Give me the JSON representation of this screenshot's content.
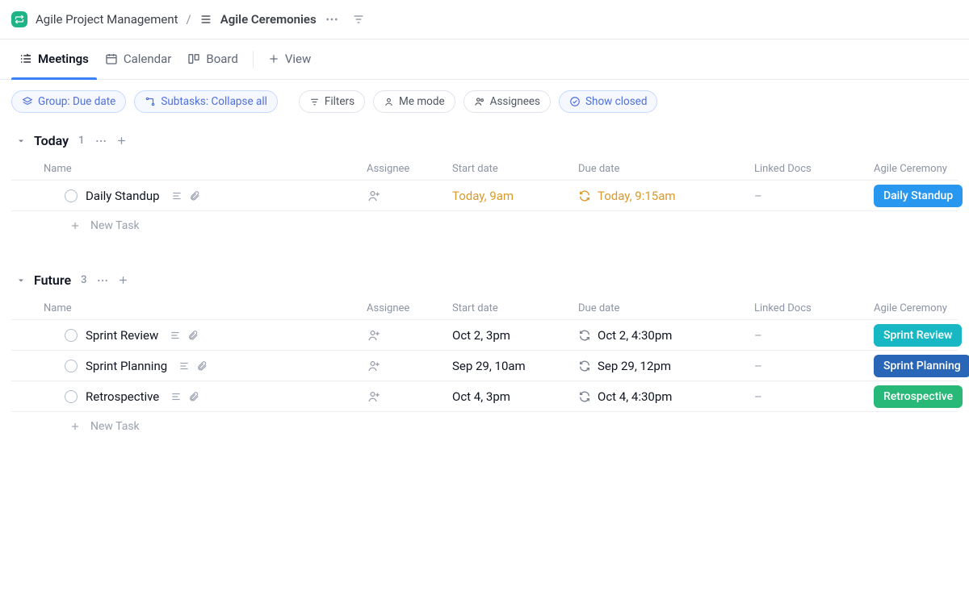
{
  "breadcrumb": {
    "space": "Agile Project Management",
    "listIcon": "list",
    "list": "Agile Ceremonies"
  },
  "tabs": [
    {
      "id": "meetings",
      "label": "Meetings",
      "icon": "list-check",
      "active": true
    },
    {
      "id": "calendar",
      "label": "Calendar",
      "icon": "calendar",
      "active": false
    },
    {
      "id": "board",
      "label": "Board",
      "icon": "board",
      "active": false
    }
  ],
  "addView": "View",
  "filters": {
    "group": "Group: Due date",
    "subtasks": "Subtasks: Collapse all",
    "filters": "Filters",
    "meMode": "Me mode",
    "assignees": "Assignees",
    "showClosed": "Show closed"
  },
  "columns": {
    "name": "Name",
    "assignee": "Assignee",
    "startDate": "Start date",
    "dueDate": "Due date",
    "linkedDocs": "Linked Docs",
    "ceremony": "Agile Ceremony"
  },
  "groups": [
    {
      "id": "today",
      "title": "Today",
      "count": "1",
      "rows": [
        {
          "name": "Daily Standup",
          "start": "Today, 9am",
          "due": "Today, 9:15am",
          "recurring": true,
          "dateStyle": "orange",
          "docs": "–",
          "tag": {
            "label": "Daily Standup",
            "color": "blue"
          }
        }
      ]
    },
    {
      "id": "future",
      "title": "Future",
      "count": "3",
      "rows": [
        {
          "name": "Sprint Review",
          "start": "Oct 2, 3pm",
          "due": "Oct 2, 4:30pm",
          "recurring": true,
          "dateStyle": "",
          "docs": "–",
          "tag": {
            "label": "Sprint Review",
            "color": "teal"
          }
        },
        {
          "name": "Sprint Planning",
          "start": "Sep 29, 10am",
          "due": "Sep 29, 12pm",
          "recurring": true,
          "dateStyle": "",
          "docs": "–",
          "tag": {
            "label": "Sprint Planning",
            "color": "navy"
          }
        },
        {
          "name": "Retrospective",
          "start": "Oct 4, 3pm",
          "due": "Oct 4, 4:30pm",
          "recurring": true,
          "dateStyle": "",
          "docs": "–",
          "tag": {
            "label": "Retrospective",
            "color": "green"
          }
        }
      ]
    }
  ],
  "newTask": "New Task"
}
